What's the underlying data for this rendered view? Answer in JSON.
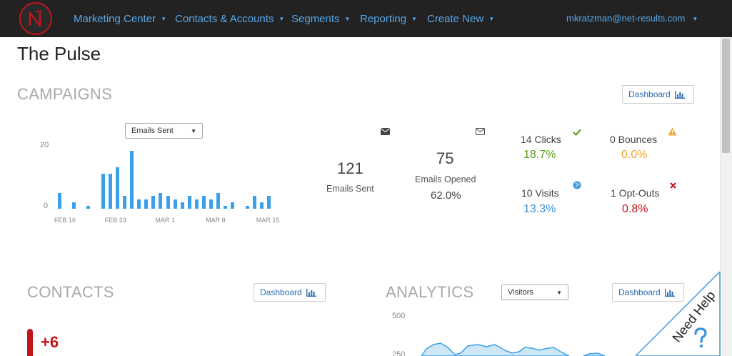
{
  "nav": {
    "items": [
      "Marketing Center",
      "Contacts & Accounts",
      "Segments",
      "Reporting",
      "Create New"
    ],
    "user": "mkratzman@net-results.com"
  },
  "page": {
    "title": "The Pulse"
  },
  "campaigns": {
    "title": "CAMPAIGNS",
    "dashboard_label": "Dashboard",
    "select_value": "Emails Sent",
    "stats": {
      "sent_count": "121",
      "sent_label": "Emails Sent",
      "opened_count": "75",
      "opened_label": "Emails Opened",
      "opened_pct": "62.0%"
    },
    "metrics": {
      "clicks": {
        "name": "14 Clicks",
        "pct": "18.7%"
      },
      "bounces": {
        "name": "0 Bounces",
        "pct": "0.0%"
      },
      "visits": {
        "name": "10 Visits",
        "pct": "13.3%"
      },
      "optouts": {
        "name": "1 Opt-Outs",
        "pct": "0.8%"
      }
    }
  },
  "contacts": {
    "title": "CONTACTS",
    "dashboard_label": "Dashboard",
    "delta": "+6"
  },
  "analytics": {
    "title": "ANALYTICS",
    "dashboard_label": "Dashboard",
    "select_value": "Visitors"
  },
  "help": {
    "label": "Need Help"
  },
  "colors": {
    "nav_bg": "#222222",
    "nav_link": "#5aa7e8",
    "bar": "#3aa0ea",
    "clicks": "#5a9e1c",
    "bounces": "#f0a52c",
    "visits": "#3a93d6",
    "optouts": "#c0151b"
  },
  "chart_data": [
    {
      "type": "bar",
      "categories": [
        "FEB 16",
        "",
        "",
        "",
        "",
        "",
        "",
        "FEB 23",
        "",
        "",
        "",
        "",
        "",
        "",
        "MAR 1",
        "",
        "",
        "",
        "",
        "",
        "",
        "MAR 8",
        "",
        "",
        "",
        "",
        "",
        "",
        "MAR 15",
        ""
      ],
      "ticks": [
        "FEB 16",
        "FEB 23",
        "MAR 1",
        "MAR 8",
        "MAR 15"
      ],
      "tick_indices": [
        0,
        7,
        14,
        21,
        28
      ],
      "values": [
        5,
        0,
        2,
        0,
        1,
        0,
        11,
        11,
        13,
        4,
        18,
        3,
        3,
        4,
        5,
        4,
        3,
        2,
        4,
        3,
        4,
        3,
        5,
        1,
        2,
        0,
        1,
        4,
        2,
        4
      ],
      "ylim": [
        0,
        20
      ],
      "yticks": [
        "20",
        "0"
      ]
    },
    {
      "type": "area",
      "yticks": [
        "500",
        "250"
      ]
    }
  ]
}
